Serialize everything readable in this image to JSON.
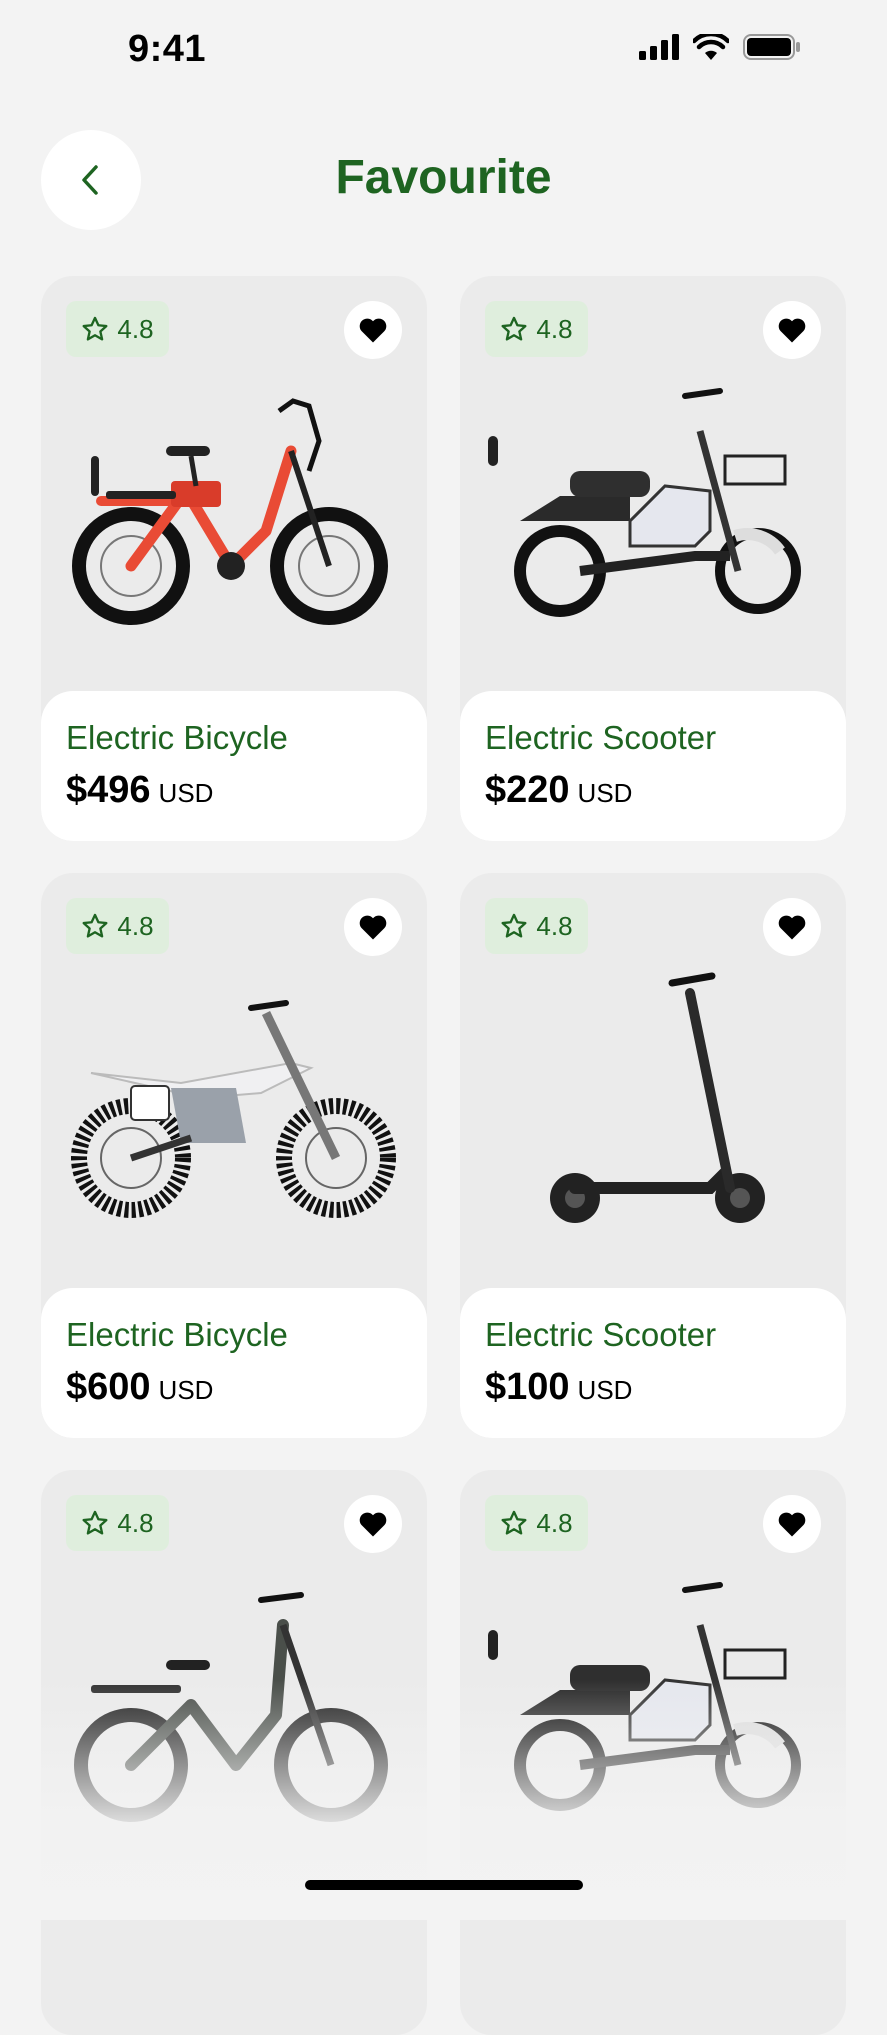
{
  "status_bar": {
    "time": "9:41"
  },
  "header": {
    "title": "Favourite"
  },
  "products": [
    {
      "rating": "4.8",
      "name": "Electric Bicycle",
      "price": "$496",
      "currency": "USD",
      "image": "electric-bicycle-red"
    },
    {
      "rating": "4.8",
      "name": "Electric Scooter",
      "price": "$220",
      "currency": "USD",
      "image": "electric-moped-white"
    },
    {
      "rating": "4.8",
      "name": "Electric Bicycle",
      "price": "$600",
      "currency": "USD",
      "image": "electric-dirt-bike"
    },
    {
      "rating": "4.8",
      "name": "Electric Scooter",
      "price": "$100",
      "currency": "USD",
      "image": "kick-scooter"
    },
    {
      "rating": "4.8",
      "image": "electric-bicycle-dark"
    },
    {
      "rating": "4.8",
      "image": "electric-moped-white"
    }
  ],
  "colors": {
    "accent": "#1e6421",
    "badge_bg": "#dfeedd",
    "card_bg": "#ebebeb",
    "page_bg": "#f3f3f3"
  }
}
